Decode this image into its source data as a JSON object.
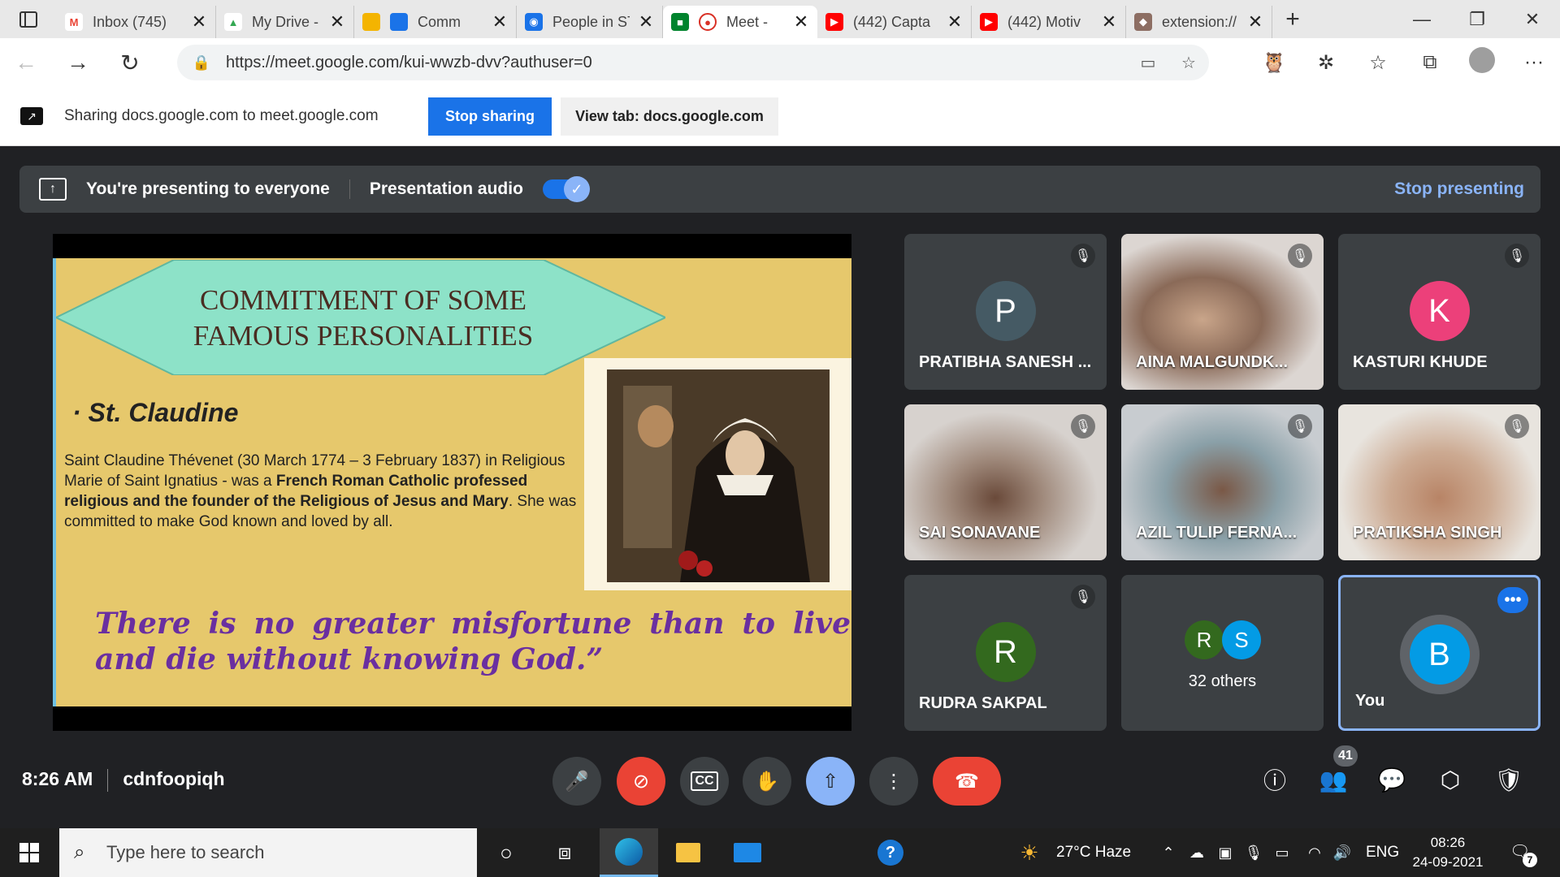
{
  "browser": {
    "tabs": [
      {
        "title": "Inbox (745)",
        "fav_color": "#ea4335",
        "fav": "M"
      },
      {
        "title": "My Drive - Google Drive",
        "fav_color": "#fbbc04",
        "fav": "▲"
      },
      {
        "title": "Comm",
        "fav_color": "#f4b400",
        "fav": "▬"
      },
      {
        "title": "People in ST",
        "fav_color": "#1a73e8",
        "fav": "👤"
      },
      {
        "title": "Meet -",
        "fav_color": "#00832d",
        "fav": "●"
      },
      {
        "title": "(442) Capta",
        "fav_color": "#ff0000",
        "fav": "▶"
      },
      {
        "title": "(442) Motiv",
        "fav_color": "#ff0000",
        "fav": "▶"
      },
      {
        "title": "extension://",
        "fav_color": "#8d6e63",
        "fav": "🦉"
      }
    ],
    "url": "https://meet.google.com/kui-wwzb-dvv?authuser=0"
  },
  "sharebar": {
    "message": "Sharing docs.google.com to meet.google.com",
    "stop_label": "Stop sharing",
    "view_label": "View tab: docs.google.com"
  },
  "presenting": {
    "message": "You're presenting to everyone",
    "audio_label": "Presentation audio",
    "stop_label": "Stop presenting"
  },
  "slide": {
    "title": "COMMITMENT OF SOME FAMOUS PERSONALITIES",
    "bullet": "· St. Claudine",
    "body_plain1": "Saint Claudine Thévenet (30 March 1774 – 3 February 1837) in Religious Marie of Saint Ignatius - was a ",
    "body_bold1": "French Roman Catholic professed religious and the founder of the Religious of Jesus and Mary",
    "body_plain2": ". She was committed to make God known and loved by all.",
    "quote": "There is no greater misfortune than to live and die without knowing God.”"
  },
  "participants": [
    {
      "name": "PRATIBHA SANESH ...",
      "initial": "P",
      "color": "#455a64"
    },
    {
      "name": "AINA MALGUNDK...",
      "initial": "",
      "color": ""
    },
    {
      "name": "KASTURI KHUDE",
      "initial": "K",
      "color": "#ec407a"
    },
    {
      "name": "SAI SONAVANE",
      "initial": "",
      "color": ""
    },
    {
      "name": "AZIL TULIP FERNA...",
      "initial": "",
      "color": ""
    },
    {
      "name": "PRATIKSHA SINGH",
      "initial": "",
      "color": ""
    },
    {
      "name": "RUDRA SAKPAL",
      "initial": "R",
      "color": "#33691e"
    }
  ],
  "others": {
    "label": "32 others",
    "initials": [
      "R",
      "S"
    ],
    "colors": [
      "#33691e",
      "#039be5"
    ]
  },
  "you": {
    "label": "You",
    "initial": "B",
    "color": "#039be5"
  },
  "meeting": {
    "time": "8:26 AM",
    "code": "cdnfoopiqh",
    "participant_count": "41"
  },
  "taskbar": {
    "search_placeholder": "Type here to search",
    "weather": "27°C  Haze",
    "language": "ENG",
    "time": "08:26",
    "date": "24-09-2021",
    "notifications": "7"
  }
}
